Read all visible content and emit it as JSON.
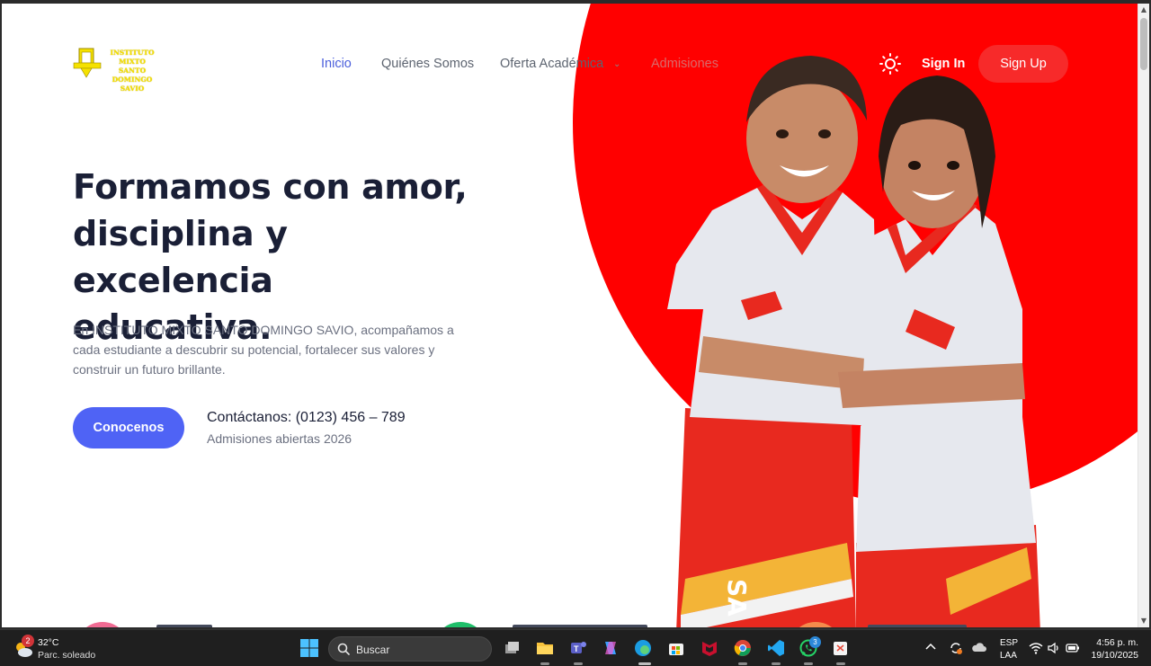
{
  "logo": {
    "line1": "INSTITUTO MIXTO",
    "line2": "SANTO DOMINGO",
    "line3": "SAVIO"
  },
  "nav": {
    "items": [
      {
        "label": "Inicio"
      },
      {
        "label": "Quiénes Somos"
      },
      {
        "label": "Oferta Académica"
      },
      {
        "label": "Admisiones"
      }
    ],
    "signin": "Sign In",
    "signup": "Sign Up"
  },
  "hero": {
    "title_line1": "Formamos con amor,",
    "title_line2": "disciplina y excelencia",
    "title_line3": "educativa.",
    "description": "En INSTITUTO MIXTO SANTO DOMINGO SAVIO, acompañamos a cada estudiante a descubrir su potencial, fortalecer sus valores y construir un futuro brillante.",
    "cta": "Conocenos",
    "contact": "Contáctanos: (0123) 456 – 789",
    "contact_sub": "Admisiones abiertas 2026"
  },
  "colors": {
    "accent": "#4f63f5",
    "brand_red": "#ff0000",
    "button_red": "#f72a2a"
  },
  "taskbar": {
    "weather_temp": "32°C",
    "weather_cond": "Parc. soleado",
    "weather_badge": "2",
    "search_placeholder": "Buscar",
    "whatsapp_badge": "3",
    "lang_line1": "ESP",
    "lang_line2": "LAA",
    "time": "4:56 p. m.",
    "date": "19/10/2025",
    "icons": [
      "windows-start-icon",
      "search-icon",
      "task-view-icon",
      "file-explorer-icon",
      "teams-icon",
      "copilot-icon",
      "edge-icon",
      "store-icon",
      "mcafee-icon",
      "chrome-icon",
      "vscode-icon",
      "whatsapp-icon",
      "snipping-tool-icon"
    ]
  }
}
